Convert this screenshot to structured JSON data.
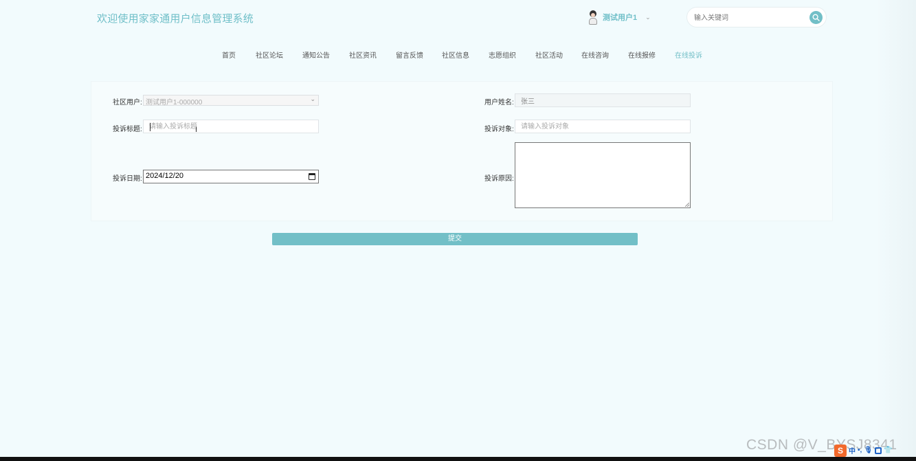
{
  "header": {
    "site_title": "欢迎使用家家通用户信息管理系统",
    "user_name": "测试用户1",
    "search_placeholder": "输入关键词"
  },
  "nav": {
    "items": [
      {
        "label": "首页",
        "active": false
      },
      {
        "label": "社区论坛",
        "active": false
      },
      {
        "label": "通知公告",
        "active": false
      },
      {
        "label": "社区资讯",
        "active": false
      },
      {
        "label": "留言反馈",
        "active": false
      },
      {
        "label": "社区信息",
        "active": false
      },
      {
        "label": "志愿组织",
        "active": false
      },
      {
        "label": "社区活动",
        "active": false
      },
      {
        "label": "在线咨询",
        "active": false
      },
      {
        "label": "在线报修",
        "active": false
      },
      {
        "label": "在线投诉",
        "active": true
      }
    ]
  },
  "form": {
    "community_user_label": "社区用户:",
    "community_user_value": "测试用户1-000000",
    "user_realname_label": "用户姓名:",
    "user_realname_value": "张三",
    "complaint_title_label": "投诉标题:",
    "complaint_title_placeholder": "请输入投诉标题",
    "complaint_target_label": "投诉对象:",
    "complaint_target_placeholder": "请输入投诉对象",
    "complaint_date_label": "投诉日期:",
    "complaint_date_value": "2024/12/20",
    "complaint_reason_label": "投诉原因:",
    "submit_label": "提交"
  },
  "overlay": {
    "watermark": "CSDN @V_BYSJ8341",
    "tray": {
      "ime_logo": "S",
      "ime_lang": "中"
    }
  },
  "colors": {
    "accent": "#72bfc7",
    "title": "#6fbfc8",
    "background": "#f2fbfd"
  }
}
